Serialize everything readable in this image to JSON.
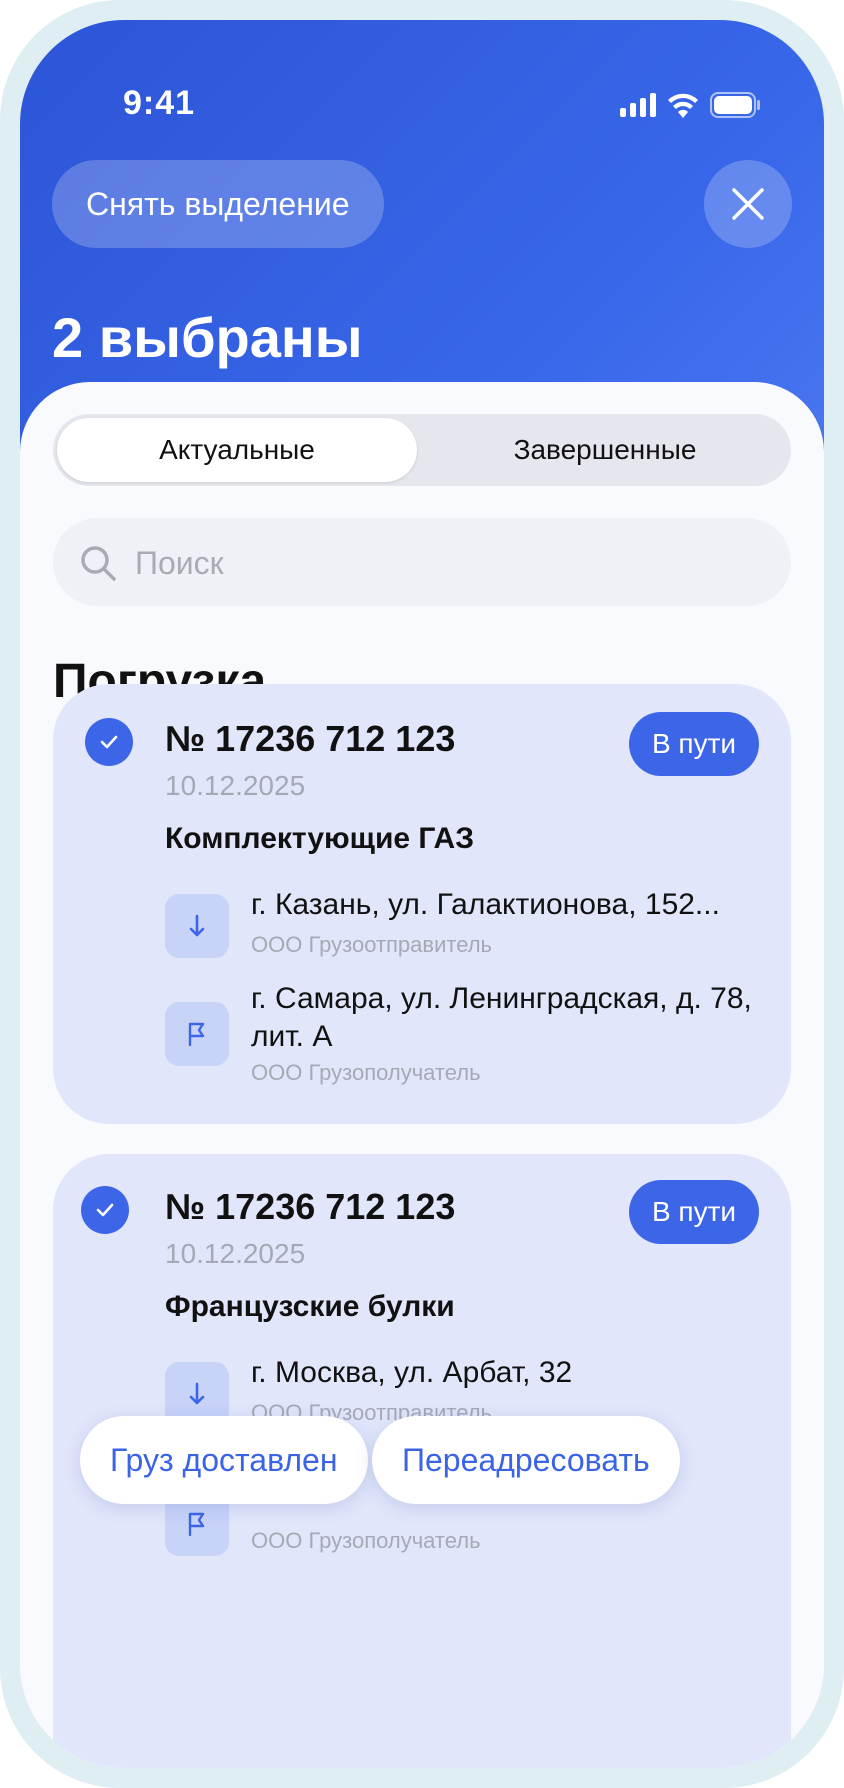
{
  "status_bar": {
    "time": "9:41"
  },
  "header": {
    "deselect_label": "Снять выделение",
    "title": "2 выбраны"
  },
  "tabs": [
    {
      "label": "Актуальные",
      "active": true
    },
    {
      "label": "Завершенные",
      "active": false
    }
  ],
  "search": {
    "placeholder": "Поиск",
    "value": ""
  },
  "section_title": "Погрузка",
  "orders": [
    {
      "number": "№ 17236 712 123",
      "status": "В пути",
      "date": "10.12.2025",
      "cargo": "Комплектующие ГАЗ",
      "selected": true,
      "from": {
        "address": "г. Казань, ул. Галактионова, 152...",
        "company": "ООО Грузоотправитель"
      },
      "to": {
        "address": "г. Самара, ул. Ленинградская, д. 78, лит. А",
        "company": "ООО Грузополучатель"
      }
    },
    {
      "number": "№ 17236 712 123",
      "status": "В пути",
      "date": "10.12.2025",
      "cargo": "Французские булки",
      "selected": true,
      "from": {
        "address": "г. Москва, ул. Арбат, 32",
        "company": "ООО Грузоотправитель"
      },
      "to": {
        "address": "",
        "company": "ООО Грузополучатель"
      }
    }
  ],
  "actions": {
    "delivered_label": "Груз доставлен",
    "redirect_label": "Переадресовать"
  },
  "colors": {
    "accent": "#3c65e8",
    "card_bg": "#e1e6fa",
    "header_bg": "#3463e4"
  }
}
